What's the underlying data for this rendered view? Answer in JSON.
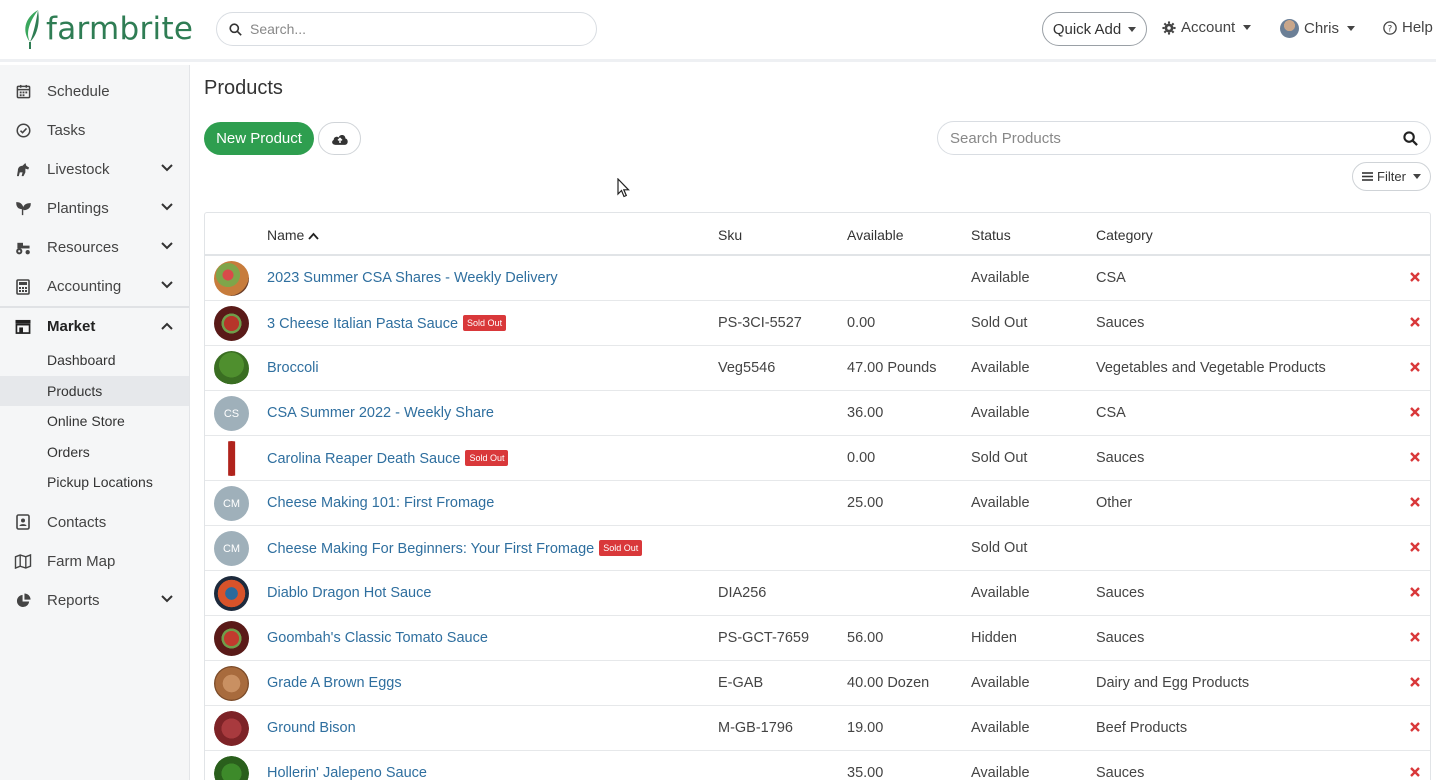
{
  "header": {
    "brand": "farmbrite",
    "search_placeholder": "Search...",
    "quick_add": "Quick Add",
    "account": "Account",
    "user": "Chris",
    "help": "Help"
  },
  "sidebar": {
    "items": [
      {
        "label": "Schedule",
        "icon": "calendar-icon"
      },
      {
        "label": "Tasks",
        "icon": "check-circle-icon"
      },
      {
        "label": "Livestock",
        "icon": "horse-icon"
      },
      {
        "label": "Plantings",
        "icon": "seedling-icon"
      },
      {
        "label": "Resources",
        "icon": "tractor-icon"
      },
      {
        "label": "Accounting",
        "icon": "calculator-icon"
      },
      {
        "label": "Market",
        "icon": "store-icon"
      },
      {
        "label": "Contacts",
        "icon": "address-book-icon"
      },
      {
        "label": "Farm Map",
        "icon": "map-icon"
      },
      {
        "label": "Reports",
        "icon": "pie-chart-icon"
      }
    ],
    "market_sub": [
      {
        "label": "Dashboard"
      },
      {
        "label": "Products"
      },
      {
        "label": "Online Store"
      },
      {
        "label": "Orders"
      },
      {
        "label": "Pickup Locations"
      }
    ]
  },
  "main": {
    "title": "Products",
    "new_product": "New Product",
    "search_placeholder": "Search Products",
    "filter": "Filter",
    "columns": {
      "name": "Name",
      "sku": "Sku",
      "available": "Available",
      "status": "Status",
      "category": "Category"
    },
    "sold_out_badge": "Sold Out",
    "rows": [
      {
        "name": "2023 Summer CSA Shares - Weekly Delivery",
        "sku": "",
        "available": "",
        "status": "Available",
        "category": "CSA",
        "badge": false,
        "initials": ""
      },
      {
        "name": "3 Cheese Italian Pasta Sauce",
        "sku": "PS-3CI-5527",
        "available": "0.00",
        "status": "Sold Out",
        "category": "Sauces",
        "badge": true,
        "initials": ""
      },
      {
        "name": "Broccoli",
        "sku": "Veg5546",
        "available": "47.00 Pounds",
        "status": "Available",
        "category": "Vegetables and Vegetable Products",
        "badge": false,
        "initials": ""
      },
      {
        "name": "CSA Summer 2022 - Weekly Share",
        "sku": "",
        "available": "36.00",
        "status": "Available",
        "category": "CSA",
        "badge": false,
        "initials": "CS"
      },
      {
        "name": "Carolina Reaper Death Sauce",
        "sku": "",
        "available": "0.00",
        "status": "Sold Out",
        "category": "Sauces",
        "badge": true,
        "initials": ""
      },
      {
        "name": "Cheese Making 101: First Fromage",
        "sku": "",
        "available": "25.00",
        "status": "Available",
        "category": "Other",
        "badge": false,
        "initials": "CM"
      },
      {
        "name": "Cheese Making For Beginners: Your First Fromage",
        "sku": "",
        "available": "",
        "status": "Sold Out",
        "category": "",
        "badge": true,
        "initials": "CM"
      },
      {
        "name": "Diablo Dragon Hot Sauce",
        "sku": "DIA256",
        "available": "",
        "status": "Available",
        "category": "Sauces",
        "badge": false,
        "initials": ""
      },
      {
        "name": "Goombah's Classic Tomato Sauce",
        "sku": "PS-GCT-7659",
        "available": "56.00",
        "status": "Hidden",
        "category": "Sauces",
        "badge": false,
        "initials": ""
      },
      {
        "name": "Grade A Brown Eggs",
        "sku": "E-GAB",
        "available": "40.00 Dozen",
        "status": "Available",
        "category": "Dairy and Egg Products",
        "badge": false,
        "initials": ""
      },
      {
        "name": "Ground Bison",
        "sku": "M-GB-1796",
        "available": "19.00",
        "status": "Available",
        "category": "Beef Products",
        "badge": false,
        "initials": ""
      },
      {
        "name": "Hollerin' Jalepeno Sauce",
        "sku": "",
        "available": "35.00",
        "status": "Available",
        "category": "Sauces",
        "badge": false,
        "initials": ""
      }
    ]
  },
  "colors": {
    "brand_green": "#2f7d54",
    "primary_button": "#2e9e4f",
    "link": "#2f6f9f",
    "danger": "#d9383a"
  }
}
